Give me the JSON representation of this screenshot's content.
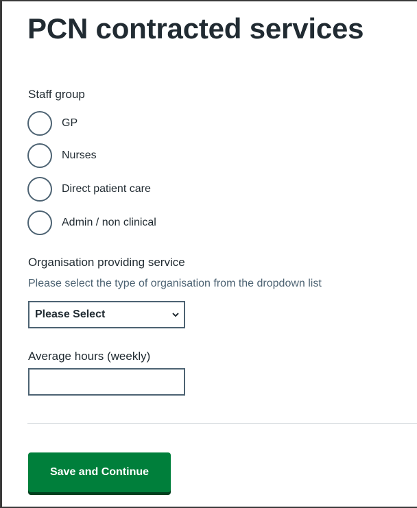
{
  "page": {
    "title": "PCN contracted services"
  },
  "staff_group": {
    "legend": "Staff group",
    "options": [
      {
        "label": "GP",
        "selected": false
      },
      {
        "label": "Nurses",
        "selected": false
      },
      {
        "label": "Direct patient care",
        "selected": false
      },
      {
        "label": "Admin / non clinical",
        "selected": false
      }
    ]
  },
  "organisation": {
    "label": "Organisation providing service",
    "hint": "Please select the type of organisation from the dropdown list",
    "selected_value": "Please Select",
    "icon": "chevron-down-icon"
  },
  "average_hours": {
    "label": "Average hours (weekly)",
    "value": ""
  },
  "actions": {
    "save_label": "Save and Continue"
  },
  "colors": {
    "text": "#212b32",
    "hint": "#4c6272",
    "border": "#4c6272",
    "button": "#007f3b",
    "button_shadow": "#00401e",
    "divider": "#d8dde0",
    "frame": "#3a3a3a"
  }
}
